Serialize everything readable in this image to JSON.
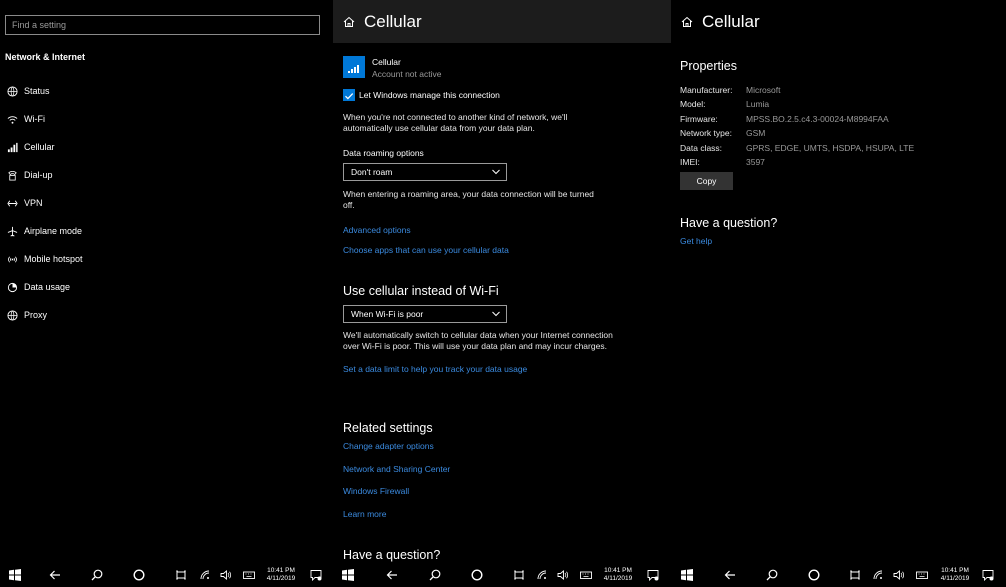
{
  "left_panel": {
    "search_placeholder": "Find a setting",
    "section": "Network & Internet",
    "nav": [
      {
        "label": "Status",
        "icon": "status-globe-icon"
      },
      {
        "label": "Wi-Fi",
        "icon": "wifi-icon"
      },
      {
        "label": "Cellular",
        "icon": "cellular-icon"
      },
      {
        "label": "Dial-up",
        "icon": "dialup-icon"
      },
      {
        "label": "VPN",
        "icon": "vpn-icon"
      },
      {
        "label": "Airplane mode",
        "icon": "airplane-icon"
      },
      {
        "label": "Mobile hotspot",
        "icon": "hotspot-icon"
      },
      {
        "label": "Data usage",
        "icon": "data-usage-icon"
      },
      {
        "label": "Proxy",
        "icon": "proxy-globe-icon"
      }
    ]
  },
  "middle_panel": {
    "title": "Cellular",
    "connection_name": "Cellular",
    "connection_status": "Account not active",
    "manage_checkbox_label": "Let Windows manage this connection",
    "manage_checked": true,
    "manage_description": "When you're not connected to another kind of network, we'll automatically use cellular data from your data plan.",
    "roaming_label": "Data roaming options",
    "roaming_value": "Don't roam",
    "roaming_description": "When entering a roaming area, your data connection will be turned off.",
    "advanced_link": "Advanced options",
    "apps_link": "Choose apps that can use your cellular data",
    "instead_heading": "Use cellular instead of Wi-Fi",
    "instead_value": "When Wi-Fi is poor",
    "instead_description": "We'll automatically switch to cellular data when your Internet connection over Wi-Fi is poor. This will use your data plan and may incur charges.",
    "data_limit_link": "Set a data limit to help you track your data usage",
    "related_heading": "Related settings",
    "related_links": [
      "Change adapter options",
      "Network and Sharing Center",
      "Windows Firewall",
      "Learn more"
    ],
    "question_heading": "Have a question?"
  },
  "right_panel": {
    "title": "Cellular",
    "properties_heading": "Properties",
    "properties": [
      {
        "key": "Manufacturer:",
        "value": "Microsoft"
      },
      {
        "key": "Model:",
        "value": "Lumia"
      },
      {
        "key": "Firmware:",
        "value": "MPSS.BO.2.5.c4.3-00024-M8994FAA"
      },
      {
        "key": "Network type:",
        "value": "GSM"
      },
      {
        "key": "Data class:",
        "value": "GPRS, EDGE, UMTS, HSDPA, HSUPA, LTE"
      },
      {
        "key": "IMEI:",
        "value": "3597"
      }
    ],
    "copy_button": "Copy",
    "question_heading": "Have a question?",
    "help_link": "Get help"
  },
  "taskbar": {
    "time": "10:41 PM",
    "date": "4/11/2019"
  },
  "colors": {
    "accent": "#0078d7",
    "link": "#3b8be0",
    "background": "#000000",
    "header_bg": "#1c1c1c"
  }
}
